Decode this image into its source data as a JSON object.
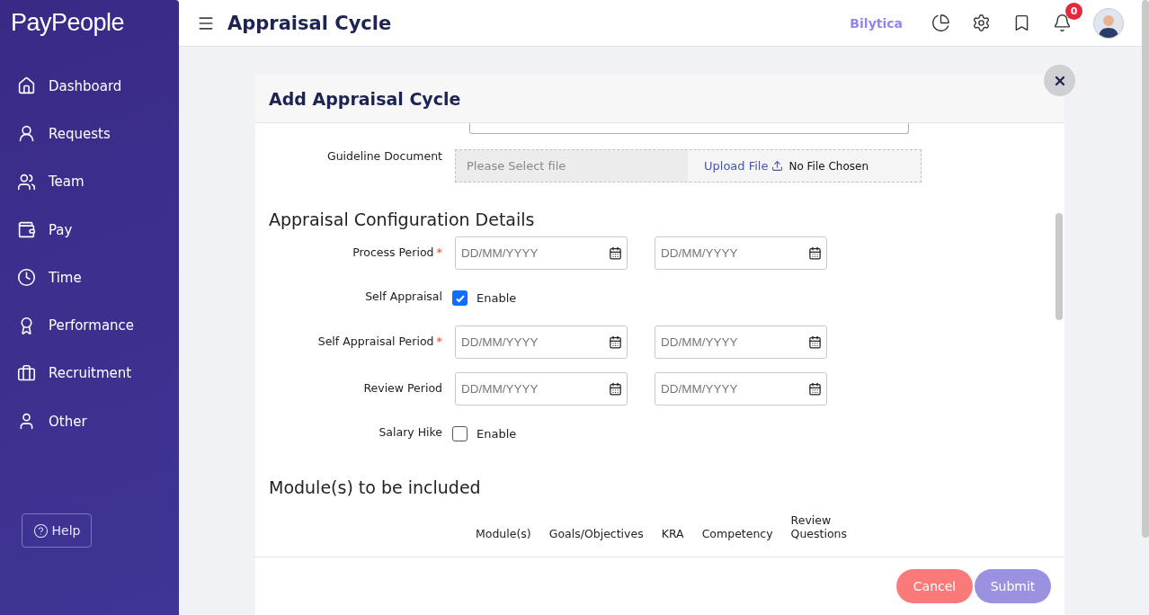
{
  "sidebar": {
    "logo": "PayPeople",
    "items": [
      {
        "label": "Dashboard"
      },
      {
        "label": "Requests"
      },
      {
        "label": "Team"
      },
      {
        "label": "Pay"
      },
      {
        "label": "Time"
      },
      {
        "label": "Performance"
      },
      {
        "label": "Recruitment"
      },
      {
        "label": "Other"
      }
    ],
    "help": "Help"
  },
  "header": {
    "title": "Appraisal Cycle",
    "company": "Bilytica",
    "notification_count": "0"
  },
  "modal": {
    "title": "Add Appraisal Cycle",
    "guideline": {
      "label": "Guideline Document",
      "placeholder": "Please Select file",
      "upload": "Upload File",
      "status": "No File Chosen"
    },
    "section_title": "Appraisal Configuration Details",
    "fields": [
      {
        "kind": "date_range",
        "label": "Process Period",
        "required_mark": "*",
        "start_placeholder": "DD/MM/YYYY",
        "end_placeholder": "DD/MM/YYYY"
      },
      {
        "kind": "checkbox",
        "label": "Self Appraisal",
        "option": "Enable",
        "checked": true
      },
      {
        "kind": "date_range",
        "label": "Self Appraisal Period",
        "required_mark": "*",
        "start_placeholder": "DD/MM/YYYY",
        "end_placeholder": "DD/MM/YYYY"
      },
      {
        "kind": "date_range",
        "label": "Review Period",
        "start_placeholder": "DD/MM/YYYY",
        "end_placeholder": "DD/MM/YYYY"
      },
      {
        "kind": "checkbox",
        "label": "Salary Hike",
        "option": "Enable",
        "checked": false
      }
    ],
    "modules_title": "Module(s) to be included",
    "modules_columns": [
      "Module(s)",
      "Goals/Objectives",
      "KRA",
      "Competency",
      "Review Questions"
    ],
    "buttons": {
      "cancel": "Cancel",
      "submit": "Submit"
    }
  }
}
